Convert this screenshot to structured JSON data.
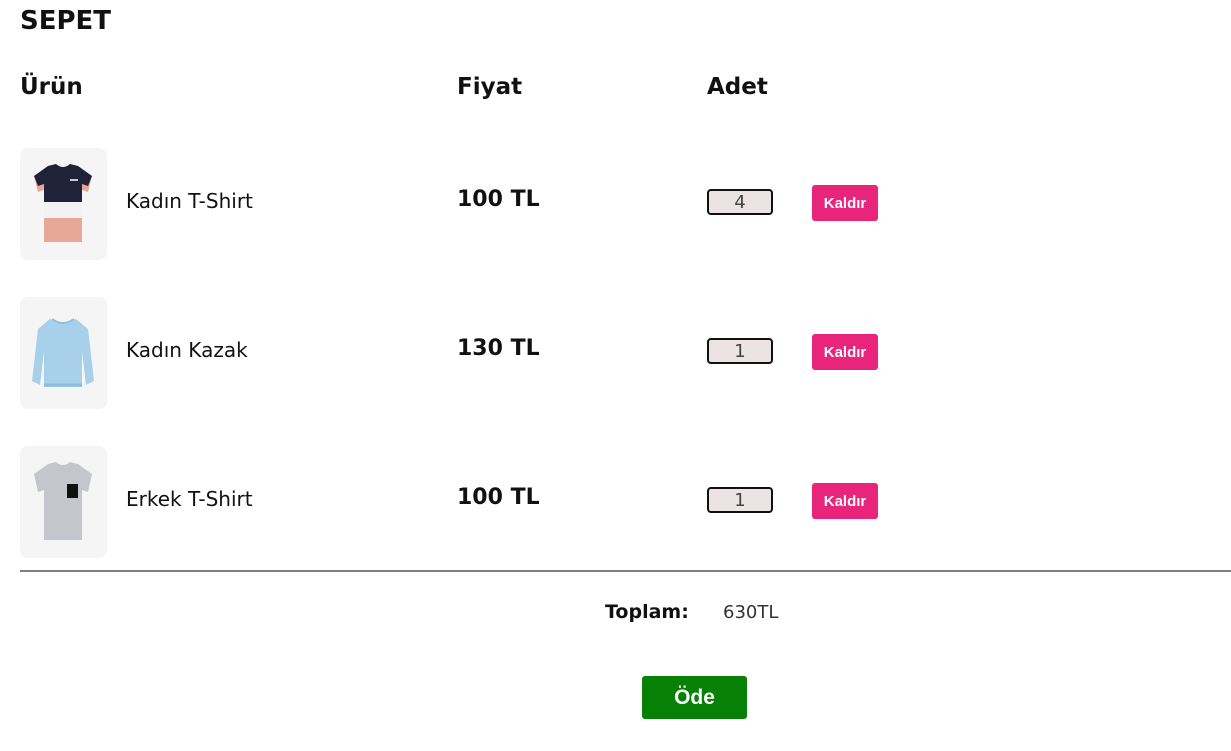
{
  "page": {
    "title": "SEPET"
  },
  "columns": {
    "product": "Ürün",
    "price": "Fiyat",
    "quantity": "Adet"
  },
  "items": [
    {
      "name": "Kadın T-Shirt",
      "price": "100 TL",
      "quantity": "4",
      "remove_label": "Kaldır",
      "image_icon": "colorblock-tshirt-icon"
    },
    {
      "name": "Kadın Kazak",
      "price": "130 TL",
      "quantity": "1",
      "remove_label": "Kaldır",
      "image_icon": "blue-sweater-icon"
    },
    {
      "name": "Erkek T-Shirt",
      "price": "100 TL",
      "quantity": "1",
      "remove_label": "Kaldır",
      "image_icon": "grey-pocket-tshirt-icon"
    }
  ],
  "summary": {
    "total_label": "Toplam:",
    "total_value": "630TL"
  },
  "actions": {
    "pay_label": "Öde"
  },
  "colors": {
    "remove_button": "#e8257b",
    "pay_button": "#068106"
  }
}
